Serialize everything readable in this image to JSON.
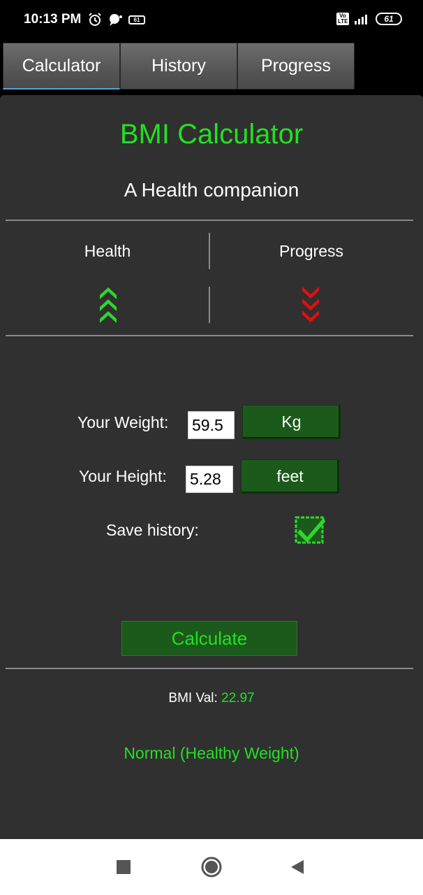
{
  "status_bar": {
    "time": "10:13 PM",
    "small_battery": "61",
    "battery": "61",
    "volte": "Vo LTE",
    "icons": [
      "alarm-icon",
      "chat-bubble-icon",
      "battery-icon",
      "volte-icon",
      "signal-icon"
    ]
  },
  "tabs": [
    {
      "label": "Calculator",
      "active": true
    },
    {
      "label": "History",
      "active": false
    },
    {
      "label": "Progress",
      "active": false
    }
  ],
  "header": {
    "title": "BMI Calculator",
    "subtitle": "A Health companion"
  },
  "indicators": {
    "health_label": "Health",
    "progress_label": "Progress",
    "health_icon": "chevrons-up-icon",
    "progress_icon": "chevrons-down-icon",
    "health_color": "#2ed62e",
    "progress_color": "#e01010"
  },
  "form": {
    "weight_label": "Your Weight:",
    "weight_value": "59.5",
    "weight_unit": "Kg",
    "height_label": "Your Height:",
    "height_value": "5.28",
    "height_unit": "feet",
    "save_history_label": "Save history:",
    "save_history_checked": true,
    "calculate_label": "Calculate"
  },
  "result": {
    "bmi_prefix": "BMI Val: ",
    "bmi_value": "22.97",
    "category": "Normal (Healthy Weight)"
  },
  "colors": {
    "accent": "#22e022",
    "panel": "#303030",
    "button": "#1b5a1b"
  },
  "nav": [
    "recents-icon",
    "home-icon",
    "back-icon"
  ]
}
